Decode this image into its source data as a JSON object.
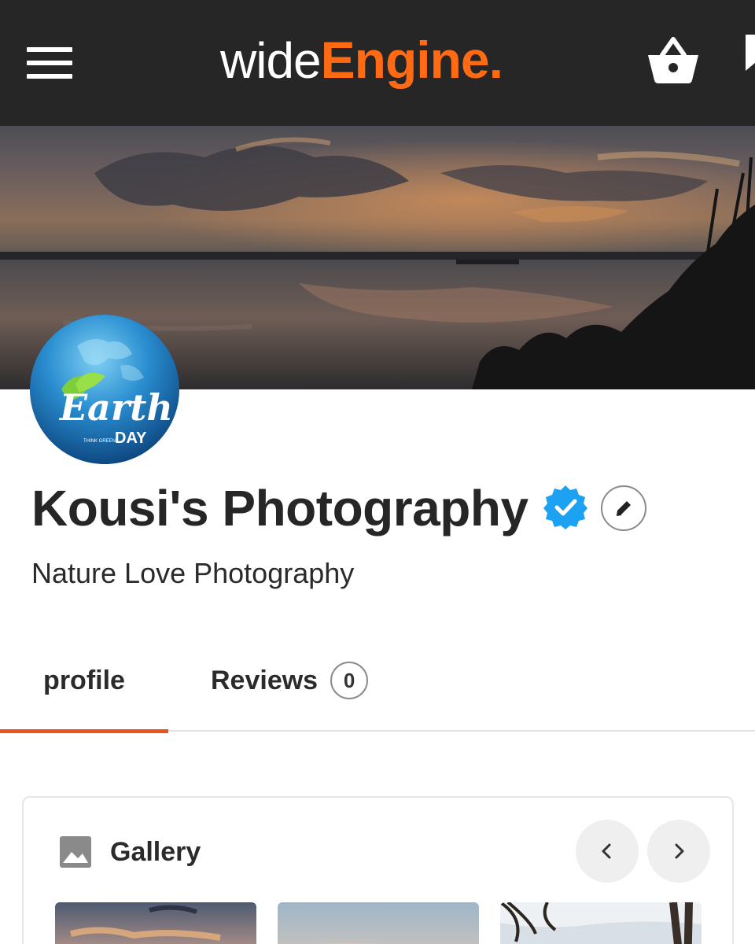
{
  "header": {
    "menu_icon": "hamburger-menu-icon",
    "logo": {
      "part1": "wide",
      "part2": "Engine",
      "part3": "."
    },
    "cart_icon": "basket-icon",
    "bookmark_icon": "bookmark-icon"
  },
  "profile": {
    "avatar_text": {
      "line1": "Earth",
      "line2": "DAY",
      "tagline": "THINK GREEN"
    },
    "name": "Kousi's Photography",
    "verified_icon": "verified-badge-icon",
    "edit_icon": "pencil-icon",
    "subtitle": "Nature Love Photography"
  },
  "tabs": [
    {
      "label": "profile",
      "active": true
    },
    {
      "label": "Reviews",
      "count": "0",
      "active": false
    }
  ],
  "gallery": {
    "icon": "image-icon",
    "title": "Gallery",
    "prev_icon": "chevron-left-icon",
    "next_icon": "chevron-right-icon",
    "thumbnails": [
      "sunset-sky",
      "hazy-sky",
      "tree-silhouette"
    ]
  },
  "colors": {
    "header_bg": "#262626",
    "brand_orange": "#ff6a13",
    "tab_underline": "#e8541a",
    "verified_blue": "#1da1f2"
  }
}
